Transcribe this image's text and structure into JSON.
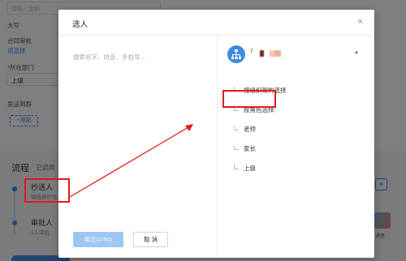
{
  "background": {
    "top_input_placeholder": "请输入金额",
    "label_daxie": "大写",
    "label_contract": "合同审批",
    "link_choose": "请选择",
    "label_dept": "*所在部门",
    "dept_value": "上级",
    "label_send_group": "发送到群",
    "add_button": "+添加",
    "flow_title": "流程",
    "flow_sub": "已启用",
    "node_cc_title": "抄送人",
    "node_cc_sub": "请选择抄送",
    "node_approver_title": "审批人",
    "node_approver_sub": "1人审批",
    "avatar_label": "满意"
  },
  "modal": {
    "title": "选人",
    "close_icon": "×",
    "search_placeholder": "搜索名字、拼音、手机号...",
    "search_value": "",
    "confirm_label": "确定(0/50)",
    "cancel_label": "取 消",
    "org": {
      "name_prefix": "/",
      "caret": "▲",
      "options": [
        {
          "label": "按组织架构选择"
        },
        {
          "label": "按角色选择"
        },
        {
          "label": "老师"
        },
        {
          "label": "家长"
        },
        {
          "label": "上级"
        }
      ]
    }
  },
  "colors": {
    "accent": "#3d8ce0",
    "highlight": "#e21919",
    "overlay": "rgba(0,0,0,0.5)"
  }
}
